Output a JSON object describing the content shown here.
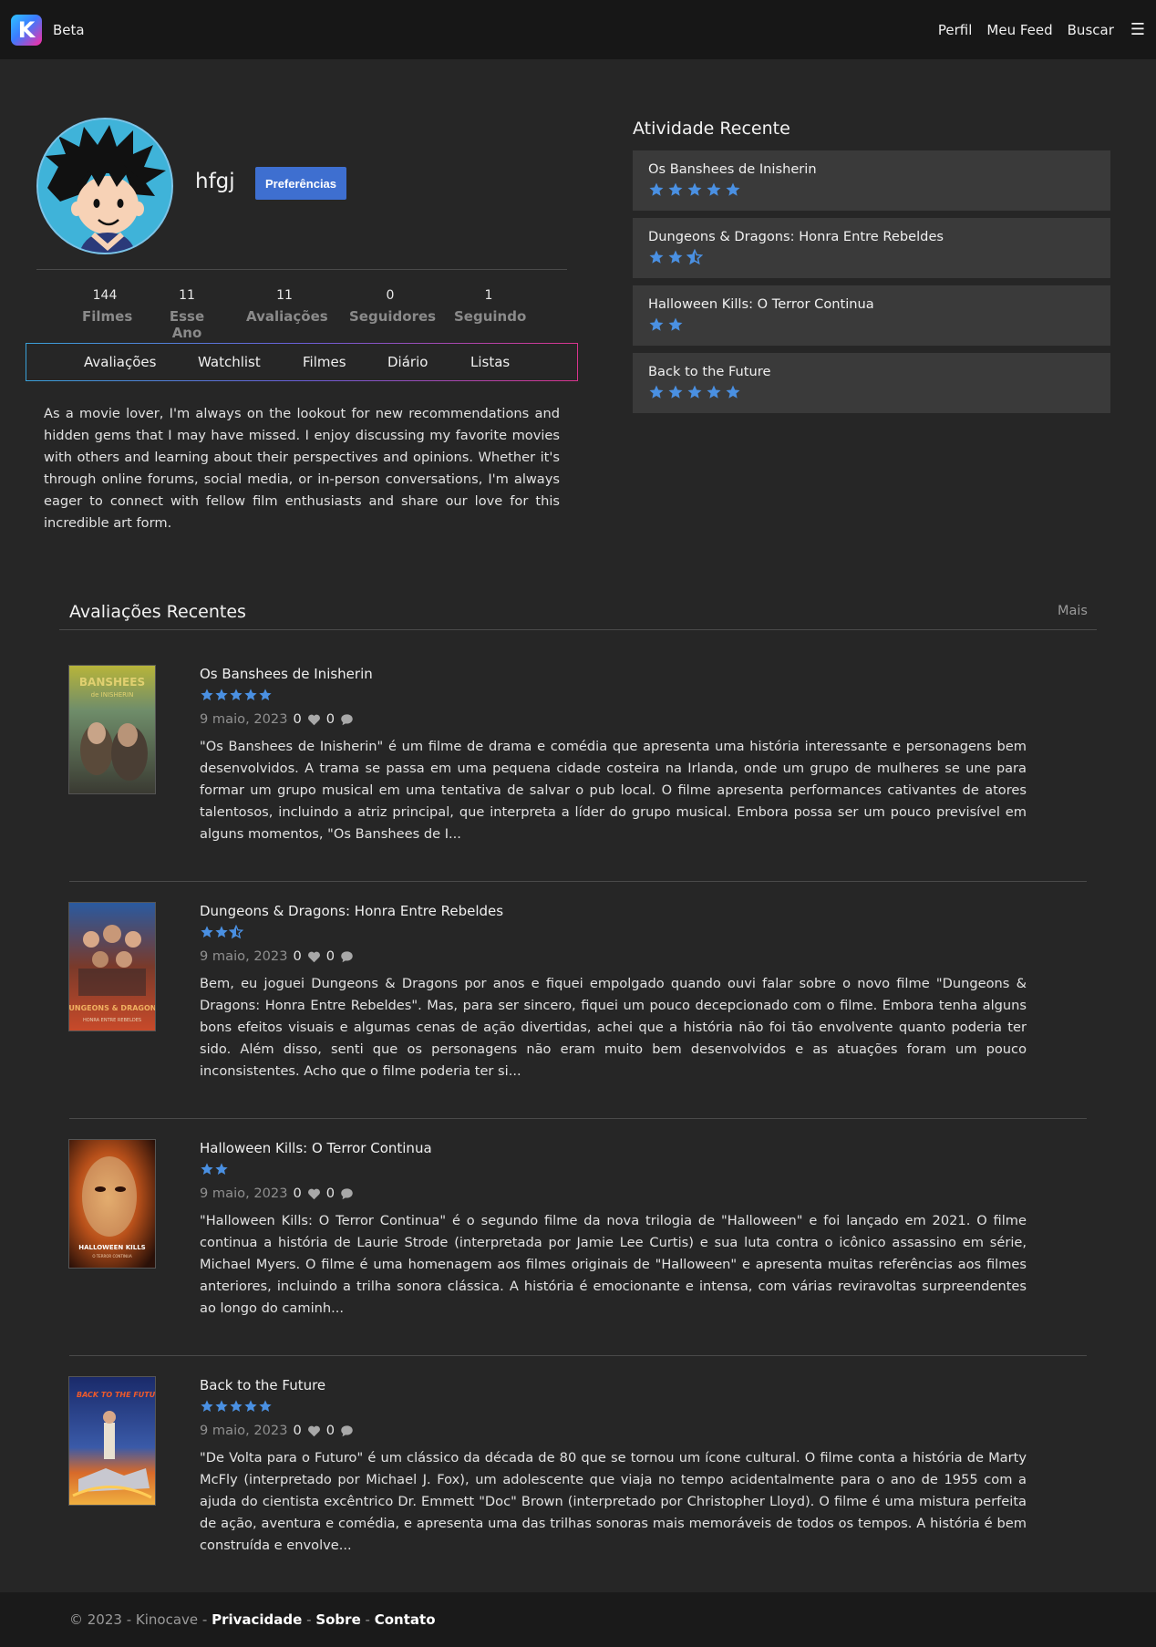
{
  "nav": {
    "logo_letter": "K",
    "brand": "Beta",
    "links": [
      "Perfil",
      "Meu Feed",
      "Buscar"
    ],
    "menu_icon": "hamburger-icon"
  },
  "profile": {
    "username": "hfgj",
    "preferences_label": "Preferências",
    "stats": [
      {
        "value": "144",
        "label": "Filmes"
      },
      {
        "value": "11",
        "label": "Esse Ano"
      },
      {
        "value": "11",
        "label": "Avaliações"
      },
      {
        "value": "0",
        "label": "Seguidores"
      },
      {
        "value": "1",
        "label": "Seguindo"
      }
    ],
    "tabs": [
      "Avaliações",
      "Watchlist",
      "Filmes",
      "Diário",
      "Listas"
    ],
    "bio": "As a movie lover, I'm always on the lookout for new recommendations and hidden gems that I may have missed. I enjoy discussing my favorite movies with others and learning about their perspectives and opinions. Whether it's through online forums, social media, or in-person conversations, I'm always eager to connect with fellow film enthusiasts and share our love for this incredible art form."
  },
  "activity": {
    "title": "Atividade Recente",
    "items": [
      {
        "title": "Os Banshees de Inisherin",
        "rating": 5
      },
      {
        "title": "Dungeons & Dragons: Honra Entre Rebeldes",
        "rating": 2.5
      },
      {
        "title": "Halloween Kills: O Terror Continua",
        "rating": 2
      },
      {
        "title": "Back to the Future",
        "rating": 5
      }
    ]
  },
  "reviews": {
    "title": "Avaliações Recentes",
    "more_label": "Mais",
    "items": [
      {
        "title": "Os Banshees de Inisherin",
        "rating": 5,
        "date": "9 maio, 2023",
        "likes": "0",
        "comments": "0",
        "poster_text": "BANSHEES",
        "poster_subtext": "de INISHERIN",
        "text": "\"Os Banshees de Inisherin\" é um filme de drama e comédia que apresenta uma história interessante e personagens bem desenvolvidos. A trama se passa em uma pequena cidade costeira na Irlanda, onde um grupo de mulheres se une para formar um grupo musical em uma tentativa de salvar o pub local. O filme apresenta performances cativantes de atores talentosos, incluindo a atriz principal, que interpreta a líder do grupo musical. Embora possa ser um pouco previsível em alguns momentos, \"Os Banshees de I..."
      },
      {
        "title": "Dungeons & Dragons: Honra Entre Rebeldes",
        "rating": 2.5,
        "date": "9 maio, 2023",
        "likes": "0",
        "comments": "0",
        "poster_text": "DUNGEONS & DRAGONS",
        "poster_subtext": "HONRA ENTRE REBELDES",
        "text": "Bem, eu joguei Dungeons & Dragons por anos e fiquei empolgado quando ouvi falar sobre o novo filme \"Dungeons & Dragons: Honra Entre Rebeldes\". Mas, para ser sincero, fiquei um pouco decepcionado com o filme. Embora tenha alguns bons efeitos visuais e algumas cenas de ação divertidas, achei que a história não foi tão envolvente quanto poderia ter sido. Além disso, senti que os personagens não eram muito bem desenvolvidos e as atuações foram um pouco inconsistentes. Acho que o filme poderia ter si..."
      },
      {
        "title": "Halloween Kills: O Terror Continua",
        "rating": 2,
        "date": "9 maio, 2023",
        "likes": "0",
        "comments": "0",
        "poster_text": "HALLOWEEN KILLS",
        "poster_subtext": "O TERROR CONTINUA",
        "text": "\"Halloween Kills: O Terror Continua\" é o segundo filme da nova trilogia de \"Halloween\" e foi lançado em 2021. O filme continua a história de Laurie Strode (interpretada por Jamie Lee Curtis) e sua luta contra o icônico assassino em série, Michael Myers. O filme é uma homenagem aos filmes originais de \"Halloween\" e apresenta muitas referências aos filmes anteriores, incluindo a trilha sonora clássica. A história é emocionante e intensa, com várias reviravoltas surpreendentes ao longo do caminh..."
      },
      {
        "title": "Back to the Future",
        "rating": 5,
        "date": "9 maio, 2023",
        "likes": "0",
        "comments": "0",
        "poster_text": "BACK TO THE FUTURE",
        "poster_subtext": "",
        "text": "\"De Volta para o Futuro\" é um clássico da década de 80 que se tornou um ícone cultural. O filme conta a história de Marty McFly (interpretado por Michael J. Fox), um adolescente que viaja no tempo acidentalmente para o ano de 1955 com a ajuda do cientista excêntrico Dr. Emmett \"Doc\" Brown (interpretado por Christopher Lloyd). O filme é uma mistura perfeita de ação, aventura e comédia, e apresenta uma das trilhas sonoras mais memoráveis de todos os tempos. A história é bem construída e envolve..."
      }
    ]
  },
  "footer": {
    "copyright": "© 2023 - Kinocave -",
    "links": [
      "Privacidade",
      "Sobre",
      "Contato"
    ],
    "separator": "-"
  },
  "colors": {
    "star": "#4a90e2",
    "accent": "#3e6fd0",
    "background": "#262626",
    "navbar": "#171717",
    "card": "#3a3a3a"
  }
}
